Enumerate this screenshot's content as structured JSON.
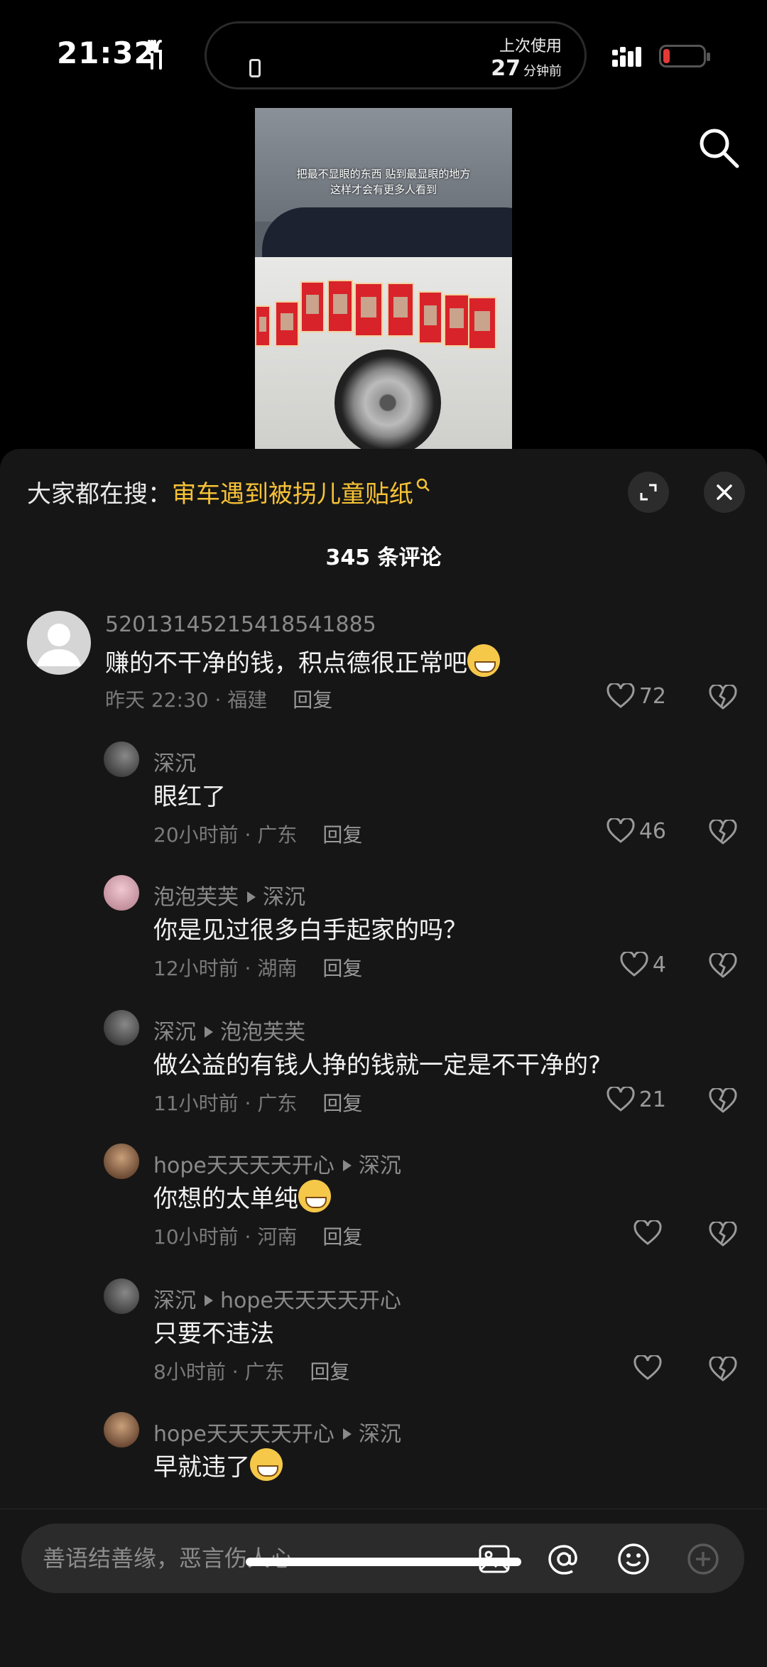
{
  "status": {
    "time": "21:32",
    "island_line1": "上次使用",
    "island_number": "27",
    "island_unit": "分钟前"
  },
  "video": {
    "caption_line1": "把最不显眼的东西 贴到最显眼的地方",
    "caption_line2": "这样才会有更多人看到"
  },
  "panel": {
    "trend_prefix": "大家都在搜：",
    "trend_keyword": "审车遇到被拐儿童贴纸",
    "comment_count": "345 条评论"
  },
  "comments": [
    {
      "user": "52013145215418541885",
      "reply_to": "",
      "text": "赚的不干净的钱，积点德很正常吧",
      "emoji": "grin",
      "time": "昨天 22:30 · 福建",
      "reply": "回复",
      "likes": "72"
    },
    {
      "user": "深沉",
      "reply_to": "",
      "text": "眼红了",
      "emoji": "",
      "time": "20小时前 · 广东",
      "reply": "回复",
      "likes": "46"
    },
    {
      "user": "泡泡芙芙",
      "reply_to": "深沉",
      "text": "你是见过很多白手起家的吗？",
      "emoji": "",
      "time": "12小时前 · 湖南",
      "reply": "回复",
      "likes": "4"
    },
    {
      "user": "深沉",
      "reply_to": "泡泡芙芙",
      "text": "做公益的有钱人挣的钱就一定是不干净的?",
      "emoji": "",
      "time": "11小时前 · 广东",
      "reply": "回复",
      "likes": "21"
    },
    {
      "user": "hope天天天天开心",
      "reply_to": "深沉",
      "text": "你想的太单纯",
      "emoji": "laugh-cry",
      "time": "10小时前 · 河南",
      "reply": "回复",
      "likes": ""
    },
    {
      "user": "深沉",
      "reply_to": "hope天天天天开心",
      "text": "只要不违法",
      "emoji": "",
      "time": "8小时前 · 广东",
      "reply": "回复",
      "likes": ""
    },
    {
      "user": "hope天天天天开心",
      "reply_to": "深沉",
      "text": "早就违了",
      "emoji": "laugh-cry",
      "time": "",
      "reply": "",
      "likes": ""
    }
  ],
  "input": {
    "placeholder": "善语结善缘，恶言伤人心"
  },
  "icons": {
    "search": "search-icon",
    "expand": "expand-icon",
    "close": "close-icon",
    "like": "heart-icon",
    "dislike": "broken-heart-icon",
    "image": "image-icon",
    "mention": "at-icon",
    "emoji": "smiley-icon",
    "add": "plus-circle-icon"
  }
}
